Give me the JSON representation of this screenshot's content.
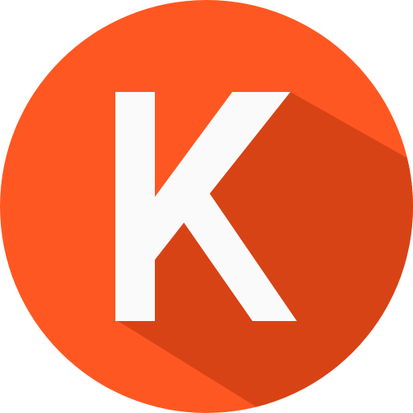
{
  "icon": {
    "letter": "K",
    "name": "k-letter-circle-icon"
  },
  "colors": {
    "circle": "#FF5722",
    "long_shadow": "#D84315",
    "letter": "#FAFAFA",
    "background": "#FFFFFF"
  }
}
